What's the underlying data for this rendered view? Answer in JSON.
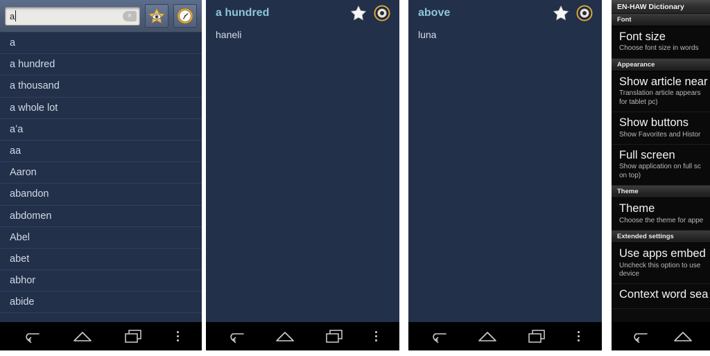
{
  "app": {
    "name": "EN-HAW Dictionary"
  },
  "colors": {
    "panel_bg": "#22304a",
    "row_divider": "#31405c",
    "title_accent": "#8fc5dd",
    "searchbar_bg": "#4c5b76",
    "settings_bg": "#0a0a0a",
    "navbar_bg": "#000000",
    "icon_gold": "#e8b44a"
  },
  "search_panel": {
    "search": {
      "value": "a",
      "placeholder": "",
      "clear_label": "×"
    },
    "favorites_button_name": "favorites",
    "history_button_name": "history",
    "words": [
      "a",
      "a hundred",
      "a thousand",
      "a whole lot",
      "aʻa",
      "aa",
      "Aaron",
      "abandon",
      "abdomen",
      "Abel",
      "abet",
      "abhor",
      "abide"
    ]
  },
  "article_panels": [
    {
      "title": "a hundred",
      "translation": "haneli",
      "star_label": "Add to favorites",
      "sound_label": "Pronounce"
    },
    {
      "title": "above",
      "translation": "luna",
      "star_label": "Add to favorites",
      "sound_label": "Pronounce"
    }
  ],
  "settings_panel": {
    "title": "EN-HAW Dictionary",
    "sections": [
      {
        "header": "Font",
        "items": [
          {
            "title": "Font size",
            "subtitle": "Choose font size in words"
          }
        ]
      },
      {
        "header": "Appearance",
        "items": [
          {
            "title": "Show article near",
            "subtitle": "Translation article appears\nfor tablet pc)"
          },
          {
            "title": "Show buttons",
            "subtitle": "Show Favorites and Histor"
          },
          {
            "title": "Full screen",
            "subtitle": "Show application on full sc\non top)"
          }
        ]
      },
      {
        "header": "Theme",
        "items": [
          {
            "title": "Theme",
            "subtitle": "Choose the theme for appe"
          }
        ]
      },
      {
        "header": "Extended settings",
        "items": [
          {
            "title": "Use apps embed",
            "subtitle": "Uncheck this option to use\ndevice"
          },
          {
            "title": "Context word sea",
            "subtitle": ""
          }
        ]
      }
    ]
  },
  "navbar": {
    "back_label": "Back",
    "home_label": "Home",
    "recents_label": "Recent apps",
    "menu_label": "More options"
  }
}
